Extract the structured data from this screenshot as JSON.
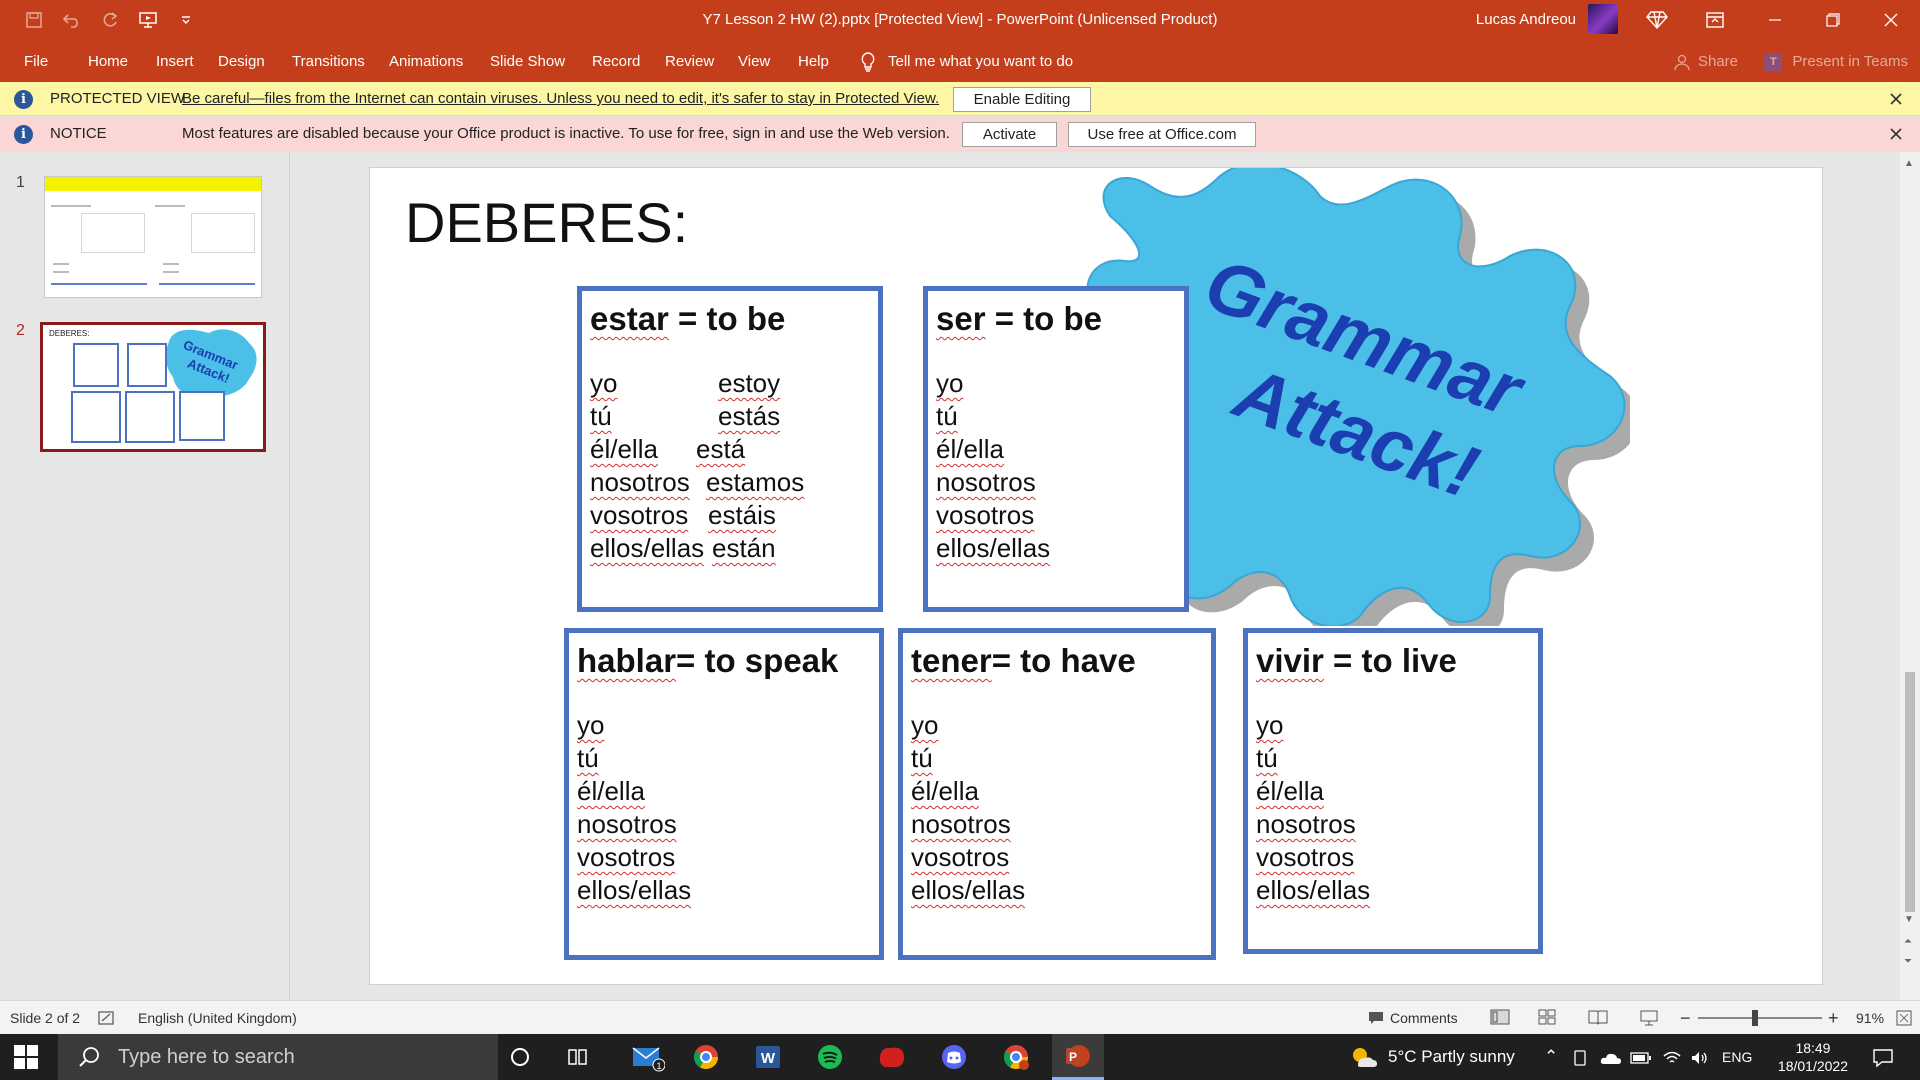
{
  "window": {
    "title": "Y7 Lesson 2 HW (2).pptx [Protected View] - PowerPoint (Unlicensed Product)",
    "user": "Lucas Andreou"
  },
  "ribbon": {
    "tabs": [
      "File",
      "Home",
      "Insert",
      "Design",
      "Transitions",
      "Animations",
      "Slide Show",
      "Record",
      "Review",
      "View",
      "Help"
    ],
    "tell_me": "Tell me what you want to do",
    "share": "Share",
    "present_in_teams": "Present in Teams",
    "teams_badge": "T"
  },
  "protected_view": {
    "label": "PROTECTED VIEW",
    "message": "Be careful—files from the Internet can contain viruses. Unless you need to edit, it's safer to stay in Protected View.",
    "button": "Enable Editing"
  },
  "notice": {
    "label": "NOTICE",
    "message": "Most features are disabled because your Office product is inactive. To use for free, sign in and use the Web version.",
    "activate": "Activate",
    "use_free": "Use free at Office.com"
  },
  "thumbnails": [
    {
      "number": "1"
    },
    {
      "number": "2",
      "title": "DEBERES:"
    }
  ],
  "slide": {
    "title": "DEBERES:",
    "splash_line1": "Grammar",
    "splash_line2": "Attack!",
    "boxes": [
      {
        "verb": "estar",
        "meaning": " = to be",
        "rows": [
          {
            "p": "yo",
            "f": "estoy"
          },
          {
            "p": "tú",
            "f": "estás"
          },
          {
            "p": "él/ella",
            "f": "está"
          },
          {
            "p": "nosotros",
            "f": "estamos"
          },
          {
            "p": "vosotros",
            "f": "estáis"
          },
          {
            "p": "ellos/ellas",
            "f": "están"
          }
        ]
      },
      {
        "verb": "ser",
        "meaning": " = to be",
        "rows": [
          {
            "p": "yo"
          },
          {
            "p": "tú"
          },
          {
            "p": "él/ella"
          },
          {
            "p": "nosotros"
          },
          {
            "p": "vosotros"
          },
          {
            "p": "ellos/ellas"
          }
        ]
      },
      {
        "verb": "hablar",
        "meaning": "= to speak",
        "rows": [
          {
            "p": "yo"
          },
          {
            "p": "tú"
          },
          {
            "p": "él/ella"
          },
          {
            "p": "nosotros"
          },
          {
            "p": "vosotros"
          },
          {
            "p": "ellos/ellas"
          }
        ]
      },
      {
        "verb": "tener",
        "meaning": "= to have",
        "rows": [
          {
            "p": "yo"
          },
          {
            "p": "tú"
          },
          {
            "p": "él/ella"
          },
          {
            "p": "nosotros"
          },
          {
            "p": "vosotros"
          },
          {
            "p": "ellos/ellas"
          }
        ]
      },
      {
        "verb": "vivir",
        "meaning": " = to live",
        "rows": [
          {
            "p": "yo"
          },
          {
            "p": "tú"
          },
          {
            "p": "él/ella"
          },
          {
            "p": "nosotros"
          },
          {
            "p": "vosotros"
          },
          {
            "p": "ellos/ellas"
          }
        ]
      }
    ]
  },
  "status": {
    "slide_of": "Slide 2 of 2",
    "language": "English (United Kingdom)",
    "comments": "Comments",
    "zoom": "91%"
  },
  "taskbar": {
    "search_placeholder": "Type here to search",
    "weather": "5°C  Partly sunny",
    "lang": "ENG",
    "time": "18:49",
    "date": "18/01/2022",
    "mail_badge": "1"
  },
  "colors": {
    "accent": "#c43e1c",
    "box_border": "#4a72c0",
    "splash": "#4cbfe8",
    "splash_text": "#1b3fb0"
  }
}
